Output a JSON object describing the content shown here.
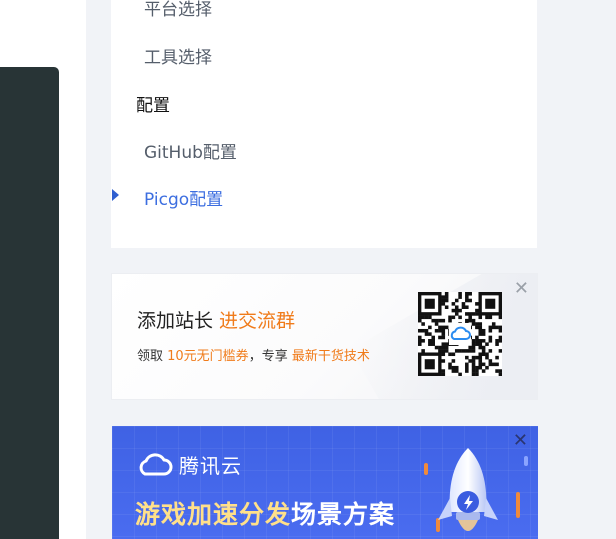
{
  "toc": {
    "items": [
      {
        "label": "平台选择",
        "kind": "item"
      },
      {
        "label": "工具选择",
        "kind": "item"
      },
      {
        "label": "配置",
        "kind": "section"
      },
      {
        "label": "GitHub配置",
        "kind": "item"
      },
      {
        "label": "Picgo配置",
        "kind": "active"
      }
    ]
  },
  "promo": {
    "title": "添加站长",
    "title_highlight": "进交流群",
    "sub_prefix": "领取 ",
    "sub_highlight1": "10元无门槛券",
    "sub_middle": "，专享 ",
    "sub_highlight2": "最新干货技术",
    "close_label": "✕",
    "accent_color": "#f07b1a"
  },
  "banner": {
    "brand": "腾讯云",
    "headline_highlight": "游戏加速分发",
    "headline_rest": "场景方案",
    "close_label": "✕",
    "bg_color": "#4167e8"
  }
}
